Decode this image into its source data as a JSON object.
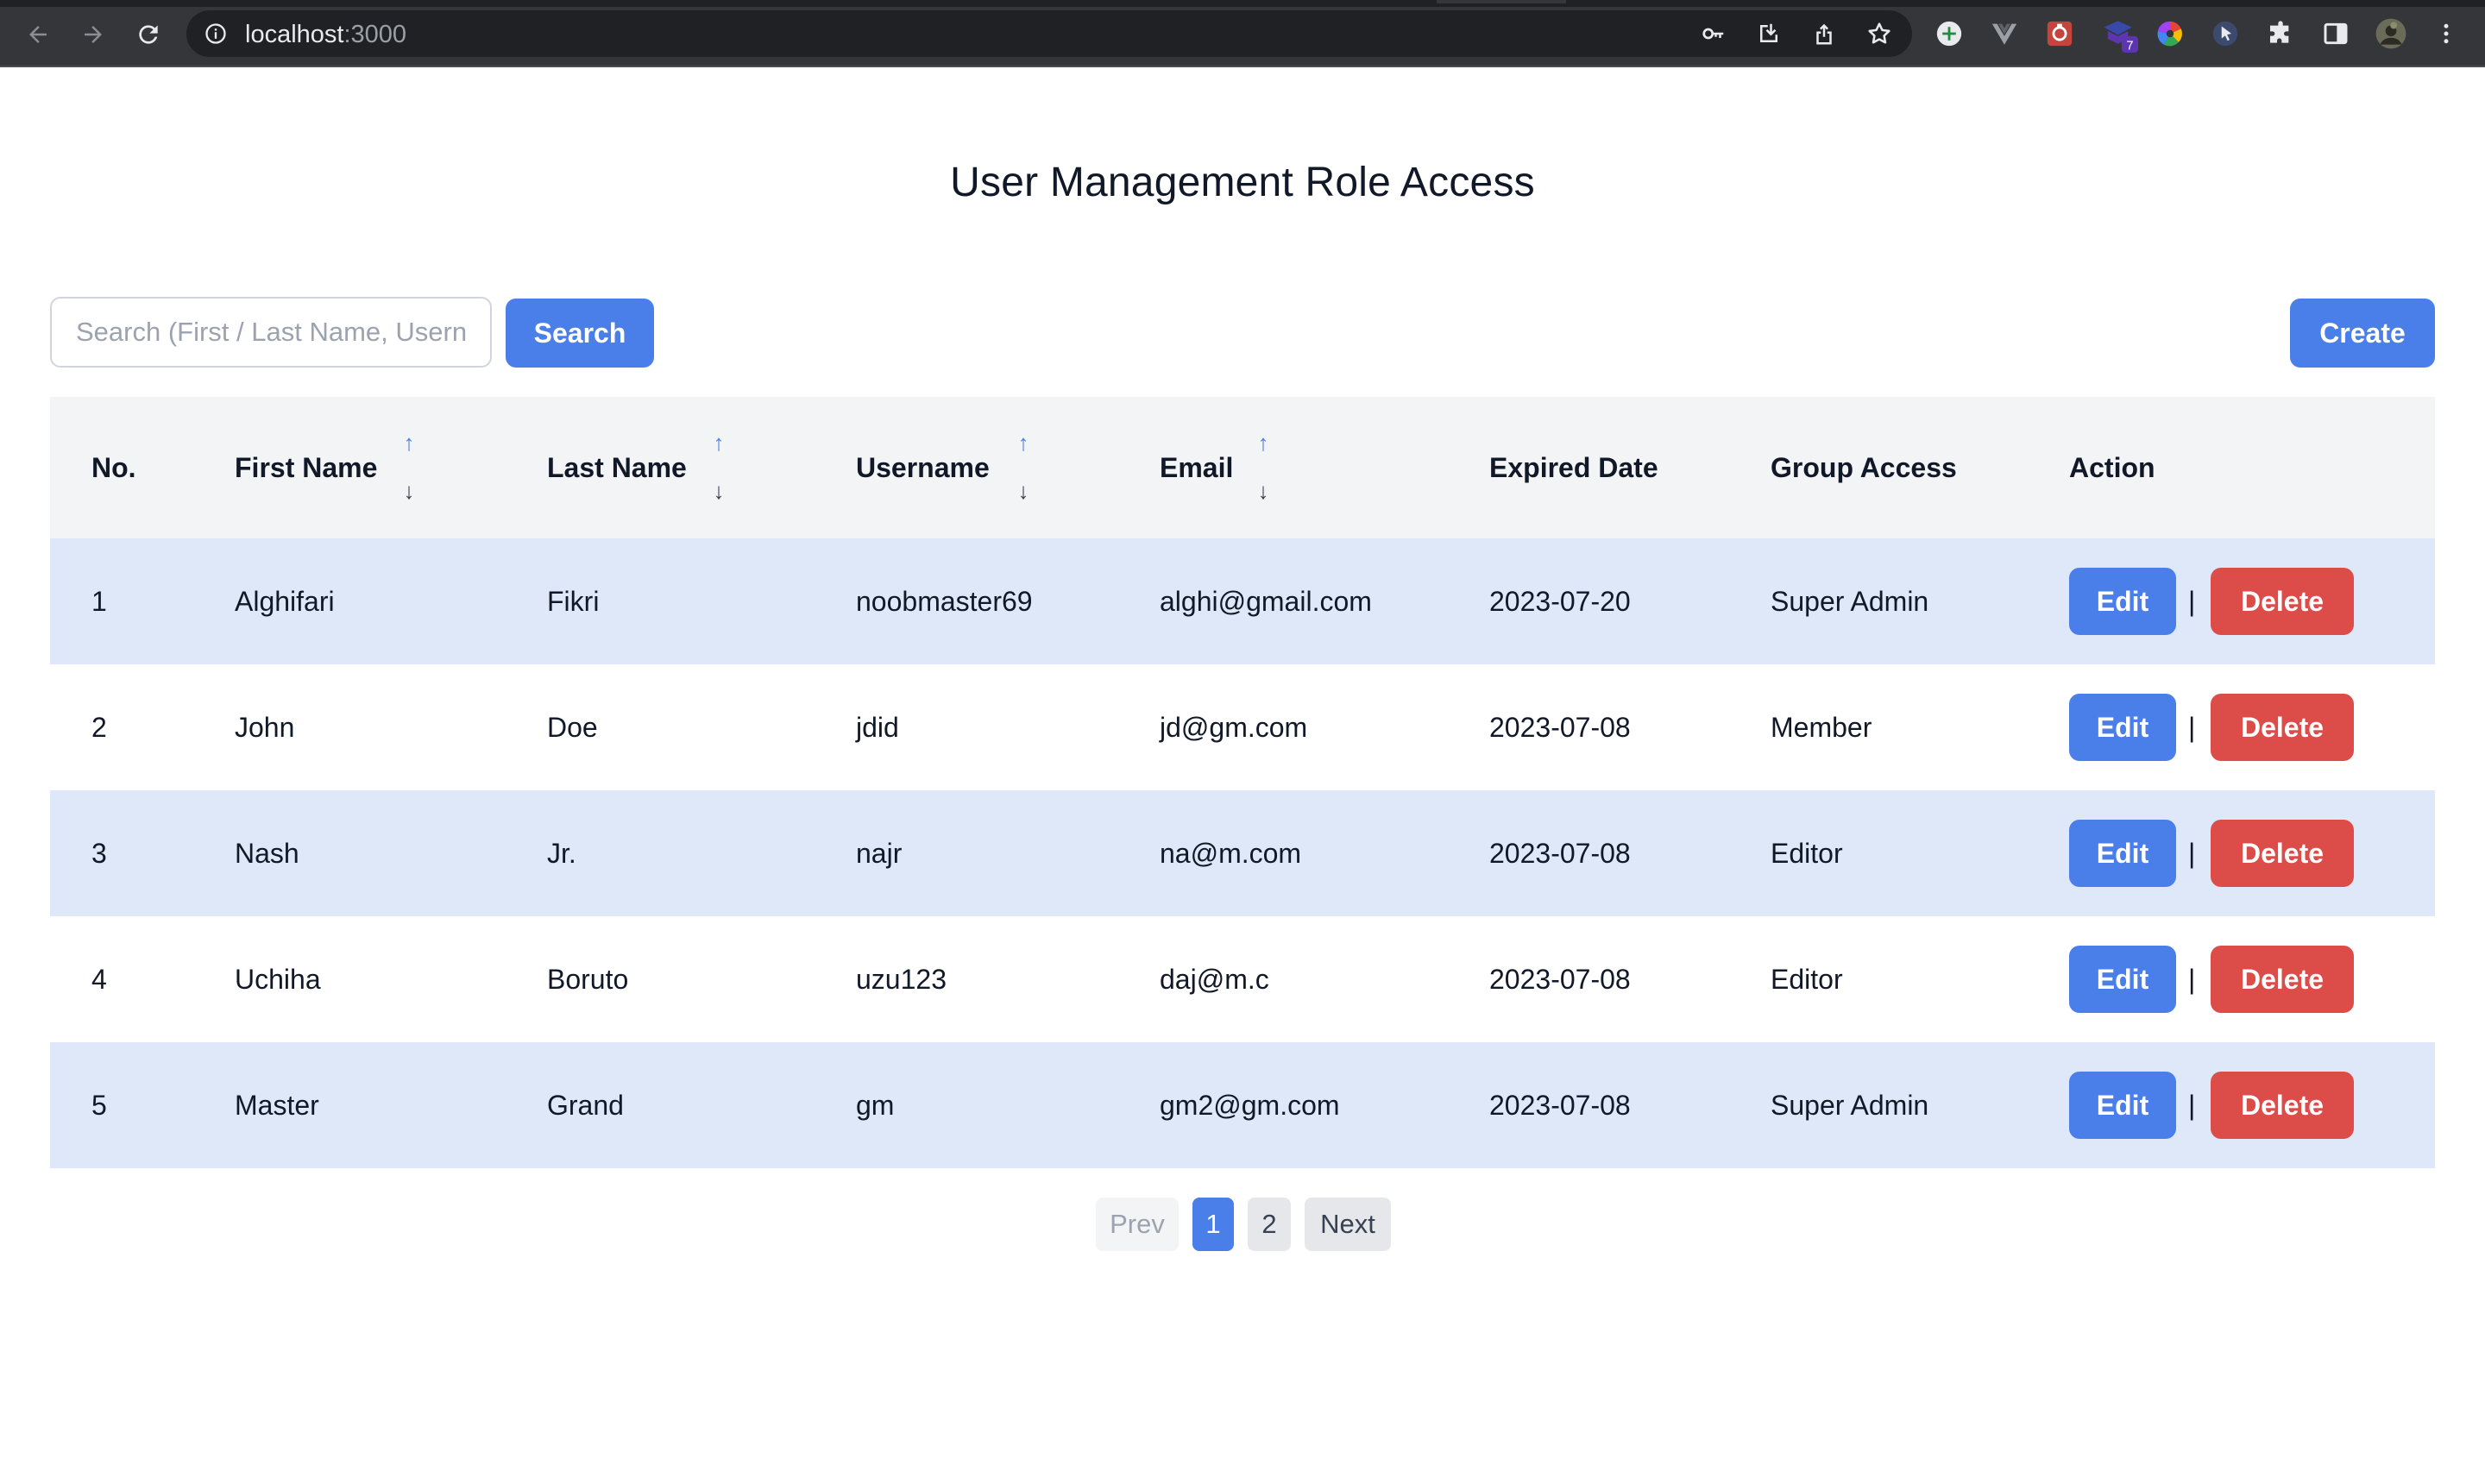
{
  "browser": {
    "url_host": "localhost",
    "url_port": ":3000",
    "extension_badge": "7"
  },
  "page": {
    "title": "User Management Role Access"
  },
  "toolbar": {
    "search_placeholder": "Search (First / Last Name, Username)",
    "search_value": "",
    "search_label": "Search",
    "create_label": "Create"
  },
  "table": {
    "headers": {
      "no": "No.",
      "first_name": "First Name",
      "last_name": "Last Name",
      "username": "Username",
      "email": "Email",
      "expired_date": "Expired Date",
      "group_access": "Group Access",
      "action": "Action"
    },
    "sort_up_glyph": "↑",
    "sort_down_glyph": "↓",
    "rows": [
      {
        "no": "1",
        "first_name": "Alghifari",
        "last_name": "Fikri",
        "username": "noobmaster69",
        "email": "alghi@gmail.com",
        "expired_date": "2023-07-20",
        "group_access": "Super Admin"
      },
      {
        "no": "2",
        "first_name": "John",
        "last_name": "Doe",
        "username": "jdid",
        "email": "jd@gm.com",
        "expired_date": "2023-07-08",
        "group_access": "Member"
      },
      {
        "no": "3",
        "first_name": "Nash",
        "last_name": "Jr.",
        "username": "najr",
        "email": "na@m.com",
        "expired_date": "2023-07-08",
        "group_access": "Editor"
      },
      {
        "no": "4",
        "first_name": "Uchiha",
        "last_name": "Boruto",
        "username": "uzu123",
        "email": "daj@m.c",
        "expired_date": "2023-07-08",
        "group_access": "Editor"
      },
      {
        "no": "5",
        "first_name": "Master",
        "last_name": "Grand",
        "username": "gm",
        "email": "gm2@gm.com",
        "expired_date": "2023-07-08",
        "group_access": "Super Admin"
      }
    ],
    "edit_label": "Edit",
    "separator": "|",
    "delete_label": "Delete"
  },
  "pagination": {
    "prev_label": "Prev",
    "pages": [
      "1",
      "2"
    ],
    "current_page": "1",
    "next_label": "Next"
  },
  "colors": {
    "primary": "#4a7ee8",
    "danger": "#dc4d4a",
    "row_stripe": "#dfe8f9",
    "header_bg": "#f3f4f6"
  }
}
